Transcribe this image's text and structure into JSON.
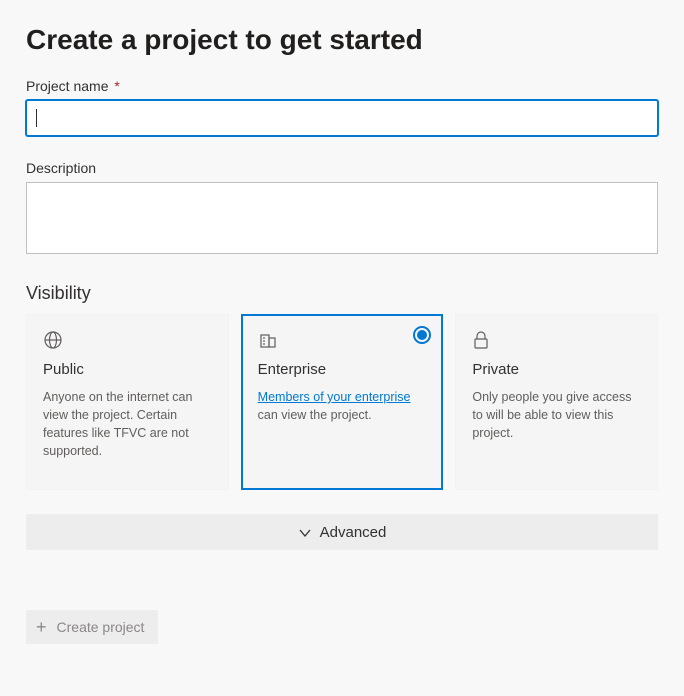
{
  "title": "Create a project to get started",
  "projectName": {
    "label": "Project name",
    "required": "*",
    "value": ""
  },
  "description": {
    "label": "Description",
    "value": ""
  },
  "visibility": {
    "label": "Visibility",
    "options": [
      {
        "key": "public",
        "title": "Public",
        "description": "Anyone on the internet can view the project. Certain features like TFVC are not supported.",
        "selected": false
      },
      {
        "key": "enterprise",
        "title": "Enterprise",
        "linkText": "Members of your enterprise",
        "descSuffix": " can view the project.",
        "selected": true
      },
      {
        "key": "private",
        "title": "Private",
        "description": "Only people you give access to will be able to view this project.",
        "selected": false
      }
    ]
  },
  "advanced": {
    "label": "Advanced"
  },
  "createButton": {
    "label": "Create project"
  }
}
